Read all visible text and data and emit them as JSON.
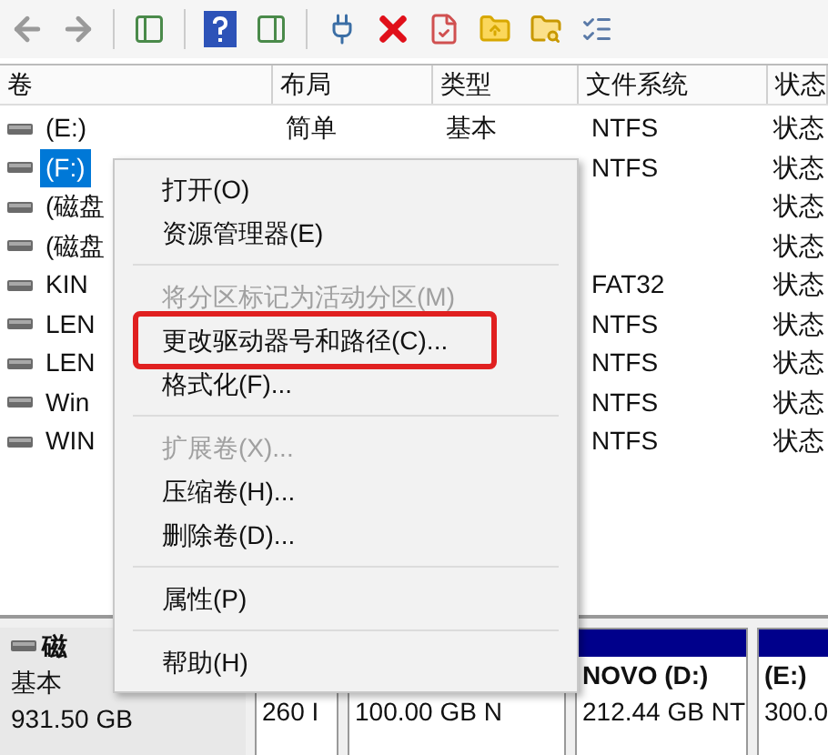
{
  "table": {
    "columns": [
      "卷",
      "布局",
      "类型",
      "文件系统",
      "状态"
    ],
    "rows": [
      {
        "volume": "(E:)",
        "layout": "简单",
        "type": "基本",
        "fs": "NTFS",
        "status": "状态",
        "selected": false
      },
      {
        "volume": "(F:)",
        "fs": "NTFS",
        "status": "状态",
        "selected": true
      },
      {
        "volume": "(磁盘",
        "status": "状态",
        "selected": false
      },
      {
        "volume": "(磁盘",
        "status": "状态",
        "selected": false
      },
      {
        "volume": "KIN",
        "fs": "FAT32",
        "status": "状态",
        "selected": false
      },
      {
        "volume": "LEN",
        "fs": "NTFS",
        "status": "状态",
        "selected": false
      },
      {
        "volume": "LEN",
        "fs": "NTFS",
        "status": "状态",
        "selected": false
      },
      {
        "volume": "Win",
        "fs": "NTFS",
        "status": "状态",
        "selected": false
      },
      {
        "volume": "WIN",
        "fs": "NTFS",
        "status": "状态",
        "selected": false
      }
    ]
  },
  "disk": {
    "name": "磁",
    "type": "基本",
    "size": "931.50 GB",
    "partitions": [
      {
        "line": "260 I"
      },
      {
        "line": "100.00 GB N"
      },
      {
        "title": "NOVO  (D:)",
        "line": "212.44 GB NT"
      },
      {
        "title": "(E:)",
        "line": "300.0"
      }
    ]
  },
  "context_menu": [
    {
      "kind": "item",
      "label": "打开(O)",
      "disabled": false,
      "annotated": false
    },
    {
      "kind": "item",
      "label": "资源管理器(E)",
      "disabled": false,
      "annotated": false
    },
    {
      "kind": "separator"
    },
    {
      "kind": "item",
      "label": "将分区标记为活动分区(M)",
      "disabled": true,
      "annotated": false
    },
    {
      "kind": "item",
      "label": "更改驱动器号和路径(C)...",
      "disabled": false,
      "annotated": true
    },
    {
      "kind": "item",
      "label": "格式化(F)...",
      "disabled": false,
      "annotated": false
    },
    {
      "kind": "separator"
    },
    {
      "kind": "item",
      "label": "扩展卷(X)...",
      "disabled": true,
      "annotated": false
    },
    {
      "kind": "item",
      "label": "压缩卷(H)...",
      "disabled": false,
      "annotated": false
    },
    {
      "kind": "item",
      "label": "删除卷(D)...",
      "disabled": false,
      "annotated": false
    },
    {
      "kind": "separator"
    },
    {
      "kind": "item",
      "label": "属性(P)",
      "disabled": false,
      "annotated": false
    },
    {
      "kind": "separator"
    },
    {
      "kind": "item",
      "label": "帮助(H)",
      "disabled": false,
      "annotated": false
    }
  ]
}
